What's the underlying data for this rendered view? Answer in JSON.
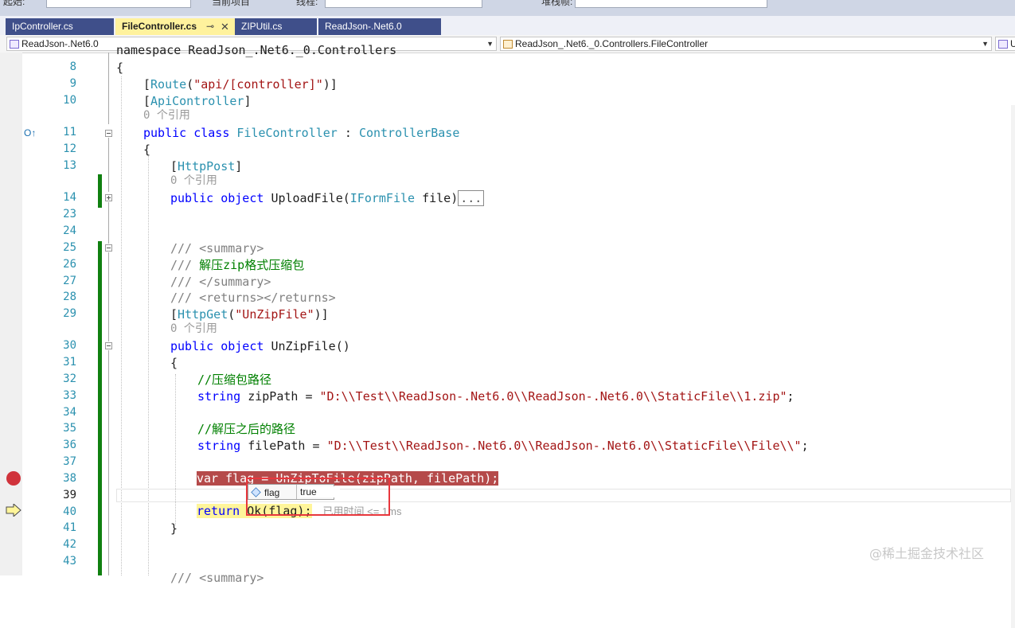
{
  "toolbar": {
    "partial_text_1": "起始:",
    "partial_text_2": "当前项目",
    "partial_text_3": "线程:",
    "partial_text_4": "堆栈帧:"
  },
  "tabs": [
    {
      "label": "IpController.cs",
      "active": false
    },
    {
      "label": "FileController.cs",
      "active": true,
      "pin_icon": "pin-icon",
      "close_icon": "close-icon"
    },
    {
      "label": "ZIPUtil.cs",
      "active": false
    },
    {
      "label": "ReadJson-.Net6.0",
      "active": false
    }
  ],
  "navbar": {
    "project": "ReadJson-.Net6.0",
    "type": "ReadJson_.Net6._0.Controllers.FileController",
    "member": "U"
  },
  "editor": {
    "line_numbers": [
      "8",
      "9",
      "10",
      "11",
      "12",
      "13",
      "14",
      "23",
      "24",
      "25",
      "26",
      "27",
      "28",
      "29",
      "30",
      "31",
      "32",
      "33",
      "34",
      "35",
      "36",
      "37",
      "38",
      "39",
      "40",
      "41",
      "42",
      "43"
    ],
    "partial_top_line": "namespace ReadJson_.Net6._0.Controllers",
    "code": {
      "l8_brace": "{",
      "l9_bracket_open": "[",
      "l9_attr": "Route",
      "l9_paren_open": "(",
      "l9_str": "\"api/[controller]\"",
      "l9_close": ")]",
      "l10_open": "[",
      "l10_attr": "ApiController",
      "l10_close": "]",
      "ref_count_1": "0 个引用",
      "l11_kw": "public class",
      "l11_name": "FileController",
      "l11_colon": ":",
      "l11_base": "ControllerBase",
      "l12_brace": "{",
      "l13_open": "[",
      "l13_attr": "HttpPost",
      "l13_close": "]",
      "ref_count_2": "0 个引用",
      "l14_kw": "public object",
      "l14_name": "UploadFile(",
      "l14_type": "IFormFile",
      "l14_param": "file)",
      "l14_collapsed": "...",
      "l25_doc": "/// ",
      "l25_tag": "<summary>",
      "l26_doc": "/// ",
      "l26_text": "解压zip格式压缩包",
      "l27_doc": "/// ",
      "l27_tag": "</summary>",
      "l28_doc": "/// ",
      "l28_tag": "<returns></returns>",
      "l29_open": "[",
      "l29_attr": "HttpGet",
      "l29_paren_open": "(",
      "l29_str": "\"UnZipFile\"",
      "l29_close": ")]",
      "ref_count_3": "0 个引用",
      "l30_kw": "public object",
      "l30_name": "UnZipFile()",
      "l31_brace": "{",
      "l32_comment": "//压缩包路径",
      "l33_kw": "string",
      "l33_rest": " zipPath = ",
      "l33_str": "\"D:\\\\Test\\\\ReadJson-.Net6.0\\\\ReadJson-.Net6.0\\\\StaticFile\\\\1.zip\"",
      "l33_end": ";",
      "l35_comment": "//解压之后的路径",
      "l36_kw": "string",
      "l36_rest": " filePath = ",
      "l36_str": "\"D:\\\\Test\\\\ReadJson-.Net6.0\\\\ReadJson-.Net6.0\\\\StaticFile\\\\File\\\\\"",
      "l36_end": ";",
      "l38_code": "var flag = UnZipToFile(zipPath, filePath);",
      "l40_kw": "return",
      "l40_rest": " Ok(flag);",
      "l40_elapsed": "已用时间 <= 1ms",
      "l41_brace": "}",
      "l44_partial": "/// <summary>"
    }
  },
  "datatip": {
    "name": "flag",
    "value": "true",
    "icon": "field-icon"
  },
  "glyphs": {
    "breakpoint_line": "38",
    "current_statement_line": "40",
    "override_glyph": "O↑"
  },
  "watermark": "@稀土掘金技术社区",
  "colors": {
    "tab_active_bg": "#fff29d",
    "tab_inactive_bg": "#3f4f8a",
    "breakpoint": "#d0333b",
    "breakpoint_band": "#b54a4a",
    "current_line_band": "#fff59a",
    "change_bar": "#108010",
    "highlight_box": "#e8373d"
  }
}
